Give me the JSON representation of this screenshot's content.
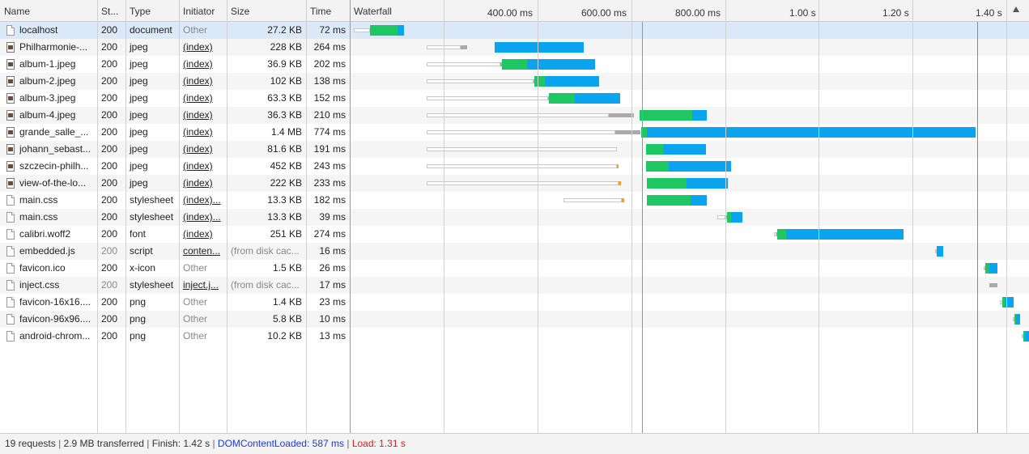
{
  "columns": {
    "name": "Name",
    "status": "St...",
    "type": "Type",
    "initiator": "Initiator",
    "size": "Size",
    "time": "Time",
    "waterfall": "Waterfall"
  },
  "ticks": [
    "400.00 ms",
    "600.00 ms",
    "800.00 ms",
    "1.00 s",
    "1.20 s",
    "1.40 s"
  ],
  "colors": {
    "ttfb": "#1ec664",
    "download": "#0aa5ee",
    "stalled": "#aaaaaa",
    "queued": "#f0a030",
    "dom_content_loaded_line": "#8a8ae6",
    "load_line": "#e06666",
    "selected_row": "#dce9f8"
  },
  "requests": [
    {
      "name": "localhost",
      "status": "200",
      "type": "document",
      "initiator": "Other",
      "size": "27.2 KB",
      "time": "72 ms",
      "icon": "document-icon",
      "selected": true
    },
    {
      "name": "Philharmonie-...",
      "status": "200",
      "type": "jpeg",
      "initiator": "(index)",
      "size": "228 KB",
      "time": "264 ms",
      "icon": "image-icon"
    },
    {
      "name": "album-1.jpeg",
      "status": "200",
      "type": "jpeg",
      "initiator": "(index)",
      "size": "36.9 KB",
      "time": "202 ms",
      "icon": "image-icon"
    },
    {
      "name": "album-2.jpeg",
      "status": "200",
      "type": "jpeg",
      "initiator": "(index)",
      "size": "102 KB",
      "time": "138 ms",
      "icon": "image-icon"
    },
    {
      "name": "album-3.jpeg",
      "status": "200",
      "type": "jpeg",
      "initiator": "(index)",
      "size": "63.3 KB",
      "time": "152 ms",
      "icon": "image-icon"
    },
    {
      "name": "album-4.jpeg",
      "status": "200",
      "type": "jpeg",
      "initiator": "(index)",
      "size": "36.3 KB",
      "time": "210 ms",
      "icon": "image-icon"
    },
    {
      "name": "grande_salle_...",
      "status": "200",
      "type": "jpeg",
      "initiator": "(index)",
      "size": "1.4 MB",
      "time": "774 ms",
      "icon": "image-icon"
    },
    {
      "name": "johann_sebast...",
      "status": "200",
      "type": "jpeg",
      "initiator": "(index)",
      "size": "81.6 KB",
      "time": "191 ms",
      "icon": "image-icon"
    },
    {
      "name": "szczecin-philh...",
      "status": "200",
      "type": "jpeg",
      "initiator": "(index)",
      "size": "452 KB",
      "time": "243 ms",
      "icon": "image-icon"
    },
    {
      "name": "view-of-the-lo...",
      "status": "200",
      "type": "jpeg",
      "initiator": "(index)",
      "size": "222 KB",
      "time": "233 ms",
      "icon": "image-icon"
    },
    {
      "name": "main.css",
      "status": "200",
      "type": "stylesheet",
      "initiator": "(index)...",
      "size": "13.3 KB",
      "time": "182 ms",
      "icon": "document-icon"
    },
    {
      "name": "main.css",
      "status": "200",
      "type": "stylesheet",
      "initiator": "(index)...",
      "size": "13.3 KB",
      "time": "39 ms",
      "icon": "document-icon"
    },
    {
      "name": "calibri.woff2",
      "status": "200",
      "type": "font",
      "initiator": "(index)",
      "size": "251 KB",
      "time": "274 ms",
      "icon": "document-icon"
    },
    {
      "name": "embedded.js",
      "status": "200",
      "type": "script",
      "initiator": "conten...",
      "size": "(from disk cac...",
      "time": "16 ms",
      "icon": "document-icon",
      "dim_status": true
    },
    {
      "name": "favicon.ico",
      "status": "200",
      "type": "x-icon",
      "initiator": "Other",
      "size": "1.5 KB",
      "time": "26 ms",
      "icon": "document-icon"
    },
    {
      "name": "inject.css",
      "status": "200",
      "type": "stylesheet",
      "initiator": "inject.j...",
      "size": "(from disk cac...",
      "time": "17 ms",
      "icon": "document-icon",
      "dim_status": true
    },
    {
      "name": "favicon-16x16....",
      "status": "200",
      "type": "png",
      "initiator": "Other",
      "size": "1.4 KB",
      "time": "23 ms",
      "icon": "document-icon"
    },
    {
      "name": "favicon-96x96....",
      "status": "200",
      "type": "png",
      "initiator": "Other",
      "size": "5.8 KB",
      "time": "10 ms",
      "icon": "document-icon"
    },
    {
      "name": "android-chrom...",
      "status": "200",
      "type": "png",
      "initiator": "Other",
      "size": "10.2 KB",
      "time": "13 ms",
      "icon": "document-icon"
    }
  ],
  "footer": {
    "requests": "19 requests",
    "transferred": "2.9 MB transferred",
    "finish": "Finish: 1.42 s",
    "dcl": "DOMContentLoaded: 587 ms",
    "load": "Load: 1.31 s",
    "separator": "|"
  }
}
